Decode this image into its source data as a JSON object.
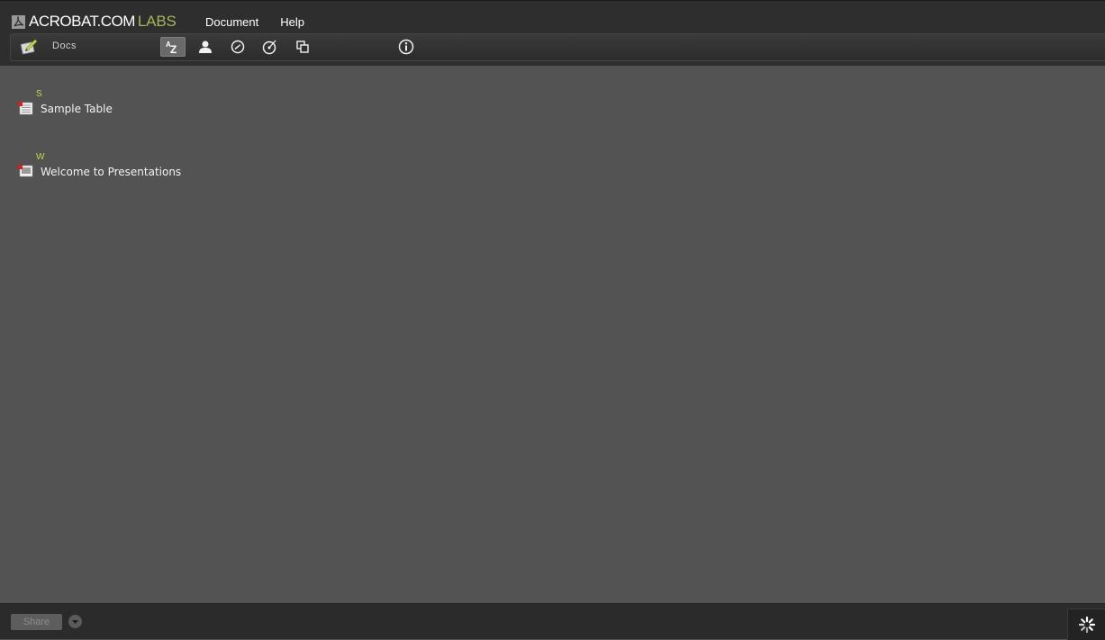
{
  "app": {
    "brand_name": "ACROBAT.COM",
    "brand_suffix": "LABS"
  },
  "menu": {
    "items": [
      {
        "label": "Document"
      },
      {
        "label": "Help"
      }
    ]
  },
  "toolbar": {
    "section_label": "Docs",
    "buttons": [
      {
        "name": "sort-az",
        "icon": "sort-az-icon",
        "active": true
      },
      {
        "name": "sort-author",
        "icon": "person-icon",
        "active": false
      },
      {
        "name": "sort-recent",
        "icon": "clock-icon",
        "active": false
      },
      {
        "name": "sort-type",
        "icon": "disc-icon",
        "active": false
      },
      {
        "name": "view-mode",
        "icon": "copy-windows-icon",
        "active": false
      },
      {
        "name": "info",
        "icon": "info-icon",
        "active": false
      }
    ]
  },
  "documents": {
    "groups": [
      {
        "letter": "S",
        "items": [
          {
            "name": "Sample Table",
            "icon": "table-doc-icon"
          }
        ]
      },
      {
        "letter": "W",
        "items": [
          {
            "name": "Welcome to Presentations",
            "icon": "presentation-doc-icon"
          }
        ]
      }
    ]
  },
  "bottom": {
    "share_label": "Share"
  },
  "colors": {
    "accent": "#a6b45a",
    "group_letter": "#c7d64a",
    "background": "#535353",
    "bar": "#2e2e2e"
  }
}
